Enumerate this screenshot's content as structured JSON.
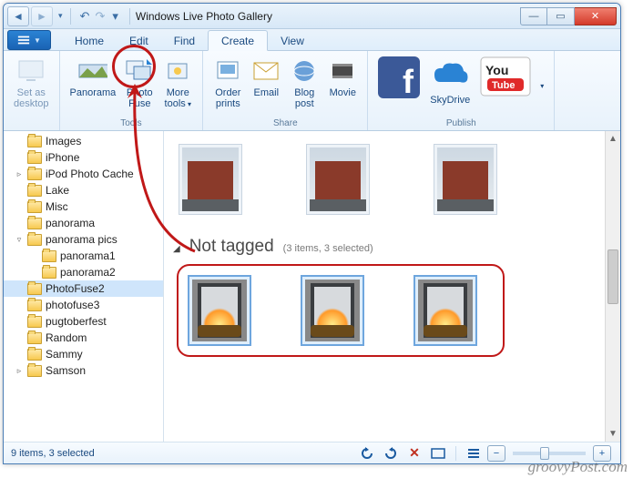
{
  "title": "Windows Live Photo Gallery",
  "tabs": {
    "home": "Home",
    "edit": "Edit",
    "find": "Find",
    "create": "Create",
    "view": "View"
  },
  "ribbon": {
    "setas": {
      "l1": "Set as",
      "l2": "desktop"
    },
    "panorama": "Panorama",
    "photofuse": {
      "l1": "Photo",
      "l2": "Fuse"
    },
    "moretools": {
      "l1": "More",
      "l2": "tools"
    },
    "group_tools": "Tools",
    "orderprints": {
      "l1": "Order",
      "l2": "prints"
    },
    "email": "Email",
    "blogpost": {
      "l1": "Blog",
      "l2": "post"
    },
    "movie": "Movie",
    "group_share": "Share",
    "skydrive": "SkyDrive",
    "youtube_svgtext": "You",
    "group_publish": "Publish"
  },
  "tree": [
    {
      "label": "Images",
      "depth": 0
    },
    {
      "label": "iPhone",
      "depth": 0
    },
    {
      "label": "iPod Photo Cache",
      "depth": 0,
      "exp": "▹"
    },
    {
      "label": "Lake",
      "depth": 0
    },
    {
      "label": "Misc",
      "depth": 0
    },
    {
      "label": "panorama",
      "depth": 0
    },
    {
      "label": "panorama pics",
      "depth": 0,
      "exp": "▿"
    },
    {
      "label": "panorama1",
      "depth": 1
    },
    {
      "label": "panorama2",
      "depth": 1
    },
    {
      "label": "PhotoFuse2",
      "depth": 0,
      "sel": true
    },
    {
      "label": "photofuse3",
      "depth": 0
    },
    {
      "label": "pugtoberfest",
      "depth": 0
    },
    {
      "label": "Random",
      "depth": 0
    },
    {
      "label": "Sammy",
      "depth": 0
    },
    {
      "label": "Samson",
      "depth": 0,
      "exp": "▹"
    }
  ],
  "content": {
    "group_title": "Not tagged",
    "group_count": "(3 items, 3 selected)"
  },
  "status": {
    "text": "9 items, 3 selected"
  },
  "watermark": "groovyPost.com"
}
